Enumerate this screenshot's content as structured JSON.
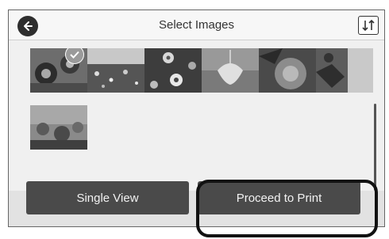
{
  "header": {
    "title": "Select Images",
    "back_icon": "back-arrow-icon",
    "sort_icon": "sort-icon"
  },
  "thumbnails": [
    {
      "name": "image-1",
      "selected": true
    },
    {
      "name": "image-2",
      "selected": false
    },
    {
      "name": "image-3",
      "selected": false
    },
    {
      "name": "image-4",
      "selected": false
    },
    {
      "name": "image-5",
      "selected": false
    },
    {
      "name": "image-6",
      "selected": false
    },
    {
      "name": "image-7",
      "selected": false
    }
  ],
  "footer": {
    "single_view_label": "Single View",
    "proceed_label": "Proceed to Print"
  }
}
